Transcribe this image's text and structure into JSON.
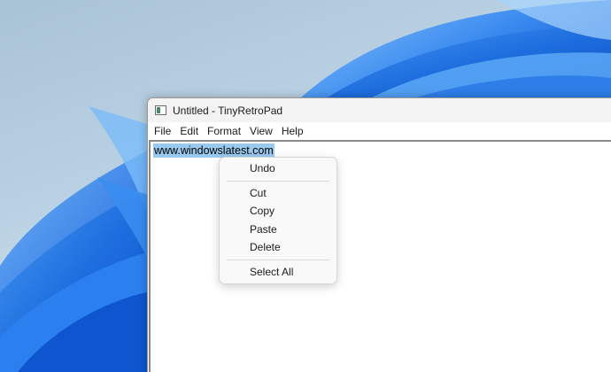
{
  "window": {
    "title": "Untitled - TinyRetroPad",
    "icon": "notepad-icon"
  },
  "menubar": {
    "items": [
      {
        "label": "File"
      },
      {
        "label": "Edit"
      },
      {
        "label": "Format"
      },
      {
        "label": "View"
      },
      {
        "label": "Help"
      }
    ]
  },
  "editor": {
    "text": "www.windowslatest.com",
    "selected": true,
    "selection_color": "#99c9ef"
  },
  "context_menu": {
    "items": {
      "undo": "Undo",
      "cut": "Cut",
      "copy": "Copy",
      "paste": "Paste",
      "delete": "Delete",
      "select_all": "Select All"
    }
  },
  "colors": {
    "wallpaper_accent": "#1f6fe0",
    "wallpaper_bg": "#b8d0e2"
  }
}
